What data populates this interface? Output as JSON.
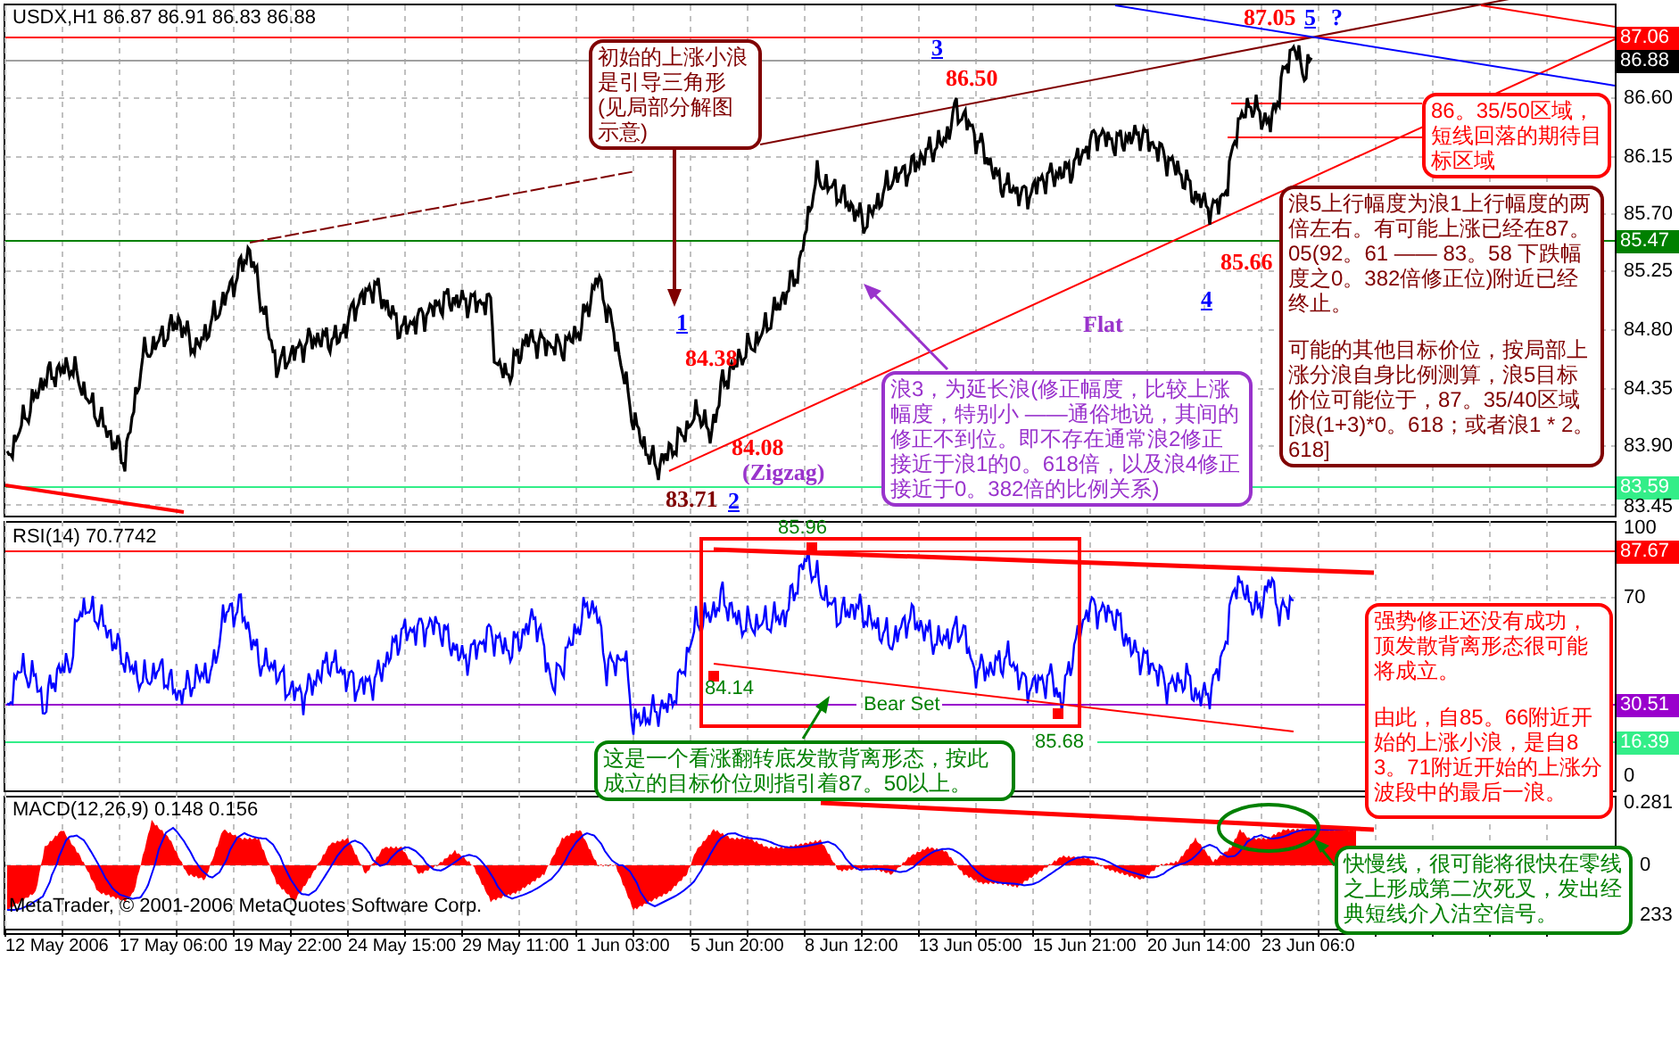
{
  "main_chart": {
    "title": "USDX,H1 86.87 86.91 86.83 86.88",
    "axis": [
      {
        "label": "87.06",
        "kind": "tag",
        "color": "#ff0000"
      },
      {
        "label": "86.88",
        "kind": "tag",
        "color": "#000000"
      },
      {
        "label": "86.60",
        "kind": "tick"
      },
      {
        "label": "86.15",
        "kind": "tick"
      },
      {
        "label": "85.70",
        "kind": "tick"
      },
      {
        "label": "85.47",
        "kind": "tag",
        "color": "#008000"
      },
      {
        "label": "85.25",
        "kind": "tick"
      },
      {
        "label": "84.80",
        "kind": "tick"
      },
      {
        "label": "84.35",
        "kind": "tick"
      },
      {
        "label": "83.90",
        "kind": "tick"
      },
      {
        "label": "83.59",
        "kind": "tag",
        "color": "#33ee88"
      },
      {
        "label": "83.45",
        "kind": "tick"
      }
    ],
    "labels": [
      {
        "text": "3",
        "kind": "wave",
        "color": "#0000ff"
      },
      {
        "text": "86.50",
        "kind": "price",
        "color": "#ff0000"
      },
      {
        "text": "87.05",
        "kind": "price",
        "color": "#ff0000"
      },
      {
        "text": "5",
        "kind": "wave",
        "color": "#0000ff"
      },
      {
        "text": "?",
        "kind": "price",
        "color": "#0000ff"
      },
      {
        "text": "1",
        "kind": "wave",
        "color": "#0000ff"
      },
      {
        "text": "84.38",
        "kind": "price",
        "color": "#ff0000"
      },
      {
        "text": "84.08",
        "kind": "price",
        "color": "#ff0000"
      },
      {
        "text": "(Zigzag)",
        "kind": "price",
        "color": "#9933cc"
      },
      {
        "text": "83.71",
        "kind": "price",
        "color": "#800000"
      },
      {
        "text": "2",
        "kind": "wave",
        "color": "#0000ff"
      },
      {
        "text": "85.66",
        "kind": "price",
        "color": "#ff0000"
      },
      {
        "text": "4",
        "kind": "wave",
        "color": "#0000ff"
      },
      {
        "text": "Flat",
        "kind": "price",
        "color": "#9933cc"
      }
    ],
    "notes": [
      {
        "color": "#800000",
        "paragraphs": [
          "初始的上涨小浪是引导三角形(见局部分解图示意)"
        ]
      },
      {
        "color": "#ff0000",
        "paragraphs": [
          "86。35/50区域，短线回落的期待目标区域"
        ]
      },
      {
        "color": "#800000",
        "paragraphs": [
          "浪5上行幅度为浪1上行幅度的两倍左右。有可能上涨已经在87。05(92。61 —— 83。58 下跌幅度之0。382倍修正位)附近已经终止。",
          "可能的其他目标价位，按局部上涨分浪自身比例测算，浪5目标价位可能位于，87。35/40区域 [浪(1+3)*0。618；或者浪1 * 2。618]"
        ]
      },
      {
        "color": "#9933cc",
        "paragraphs": [
          "浪3，为延长浪(修正幅度，比较上涨幅度，特别小 ——通俗地说，其间的修正不到位。即不存在通常浪2修正接近于浪1的0。618倍，以及浪4修正接近于0。382倍的比例关系)"
        ]
      }
    ]
  },
  "rsi": {
    "title": "RSI(14) 70.7742",
    "axis": [
      {
        "label": "100",
        "kind": "tick"
      },
      {
        "label": "87.67",
        "kind": "tag",
        "color": "#ff0000"
      },
      {
        "label": "70",
        "kind": "tick"
      },
      {
        "label": "30.51",
        "kind": "tag",
        "color": "#9900cc"
      },
      {
        "label": "16.39",
        "kind": "tag",
        "color": "#33ee88"
      },
      {
        "label": "0",
        "kind": "tick"
      }
    ],
    "labels": [
      {
        "text": "85.96"
      },
      {
        "text": "84.14"
      },
      {
        "text": "Bear Set"
      },
      {
        "text": "85.68"
      }
    ],
    "notes": [
      {
        "color": "#008000",
        "paragraphs": [
          "这是一个看涨翻转底发散背离形态，按此成立的目标价位则指引着87。50以上。"
        ]
      },
      {
        "color": "#ff0000",
        "paragraphs": [
          "强势修正还没有成功，顶发散背离形态很可能将成立。",
          "由此，自85。66附近开始的上涨小浪，是自83。71附近开始的上涨分波段中的最后一浪。"
        ]
      }
    ]
  },
  "macd": {
    "title": "MACD(12,26,9) 0.148 0.156",
    "axis": [
      {
        "label": "0.281",
        "kind": "tick"
      },
      {
        "label": "0",
        "kind": "tick"
      },
      {
        "label": "233",
        "kind": "tick"
      }
    ],
    "copyright": "MetaTrader, © 2001-2006 MetaQuotes Software Corp.",
    "notes": [
      {
        "color": "#008000",
        "paragraphs": [
          "快慢线，很可能将很快在零线之上形成第二次死叉，发出经典短线介入沽空信号。"
        ]
      }
    ]
  },
  "time_axis": [
    "12 May 2006",
    "17 May 06:00",
    "19 May 22:00",
    "24 May 15:00",
    "29 May 11:00",
    "1 Jun 03:00",
    "5 Jun 20:00",
    "8 Jun 12:00",
    "13 Jun 05:00",
    "15 Jun 21:00",
    "20 Jun 14:00",
    "23 Jun 06:0"
  ]
}
